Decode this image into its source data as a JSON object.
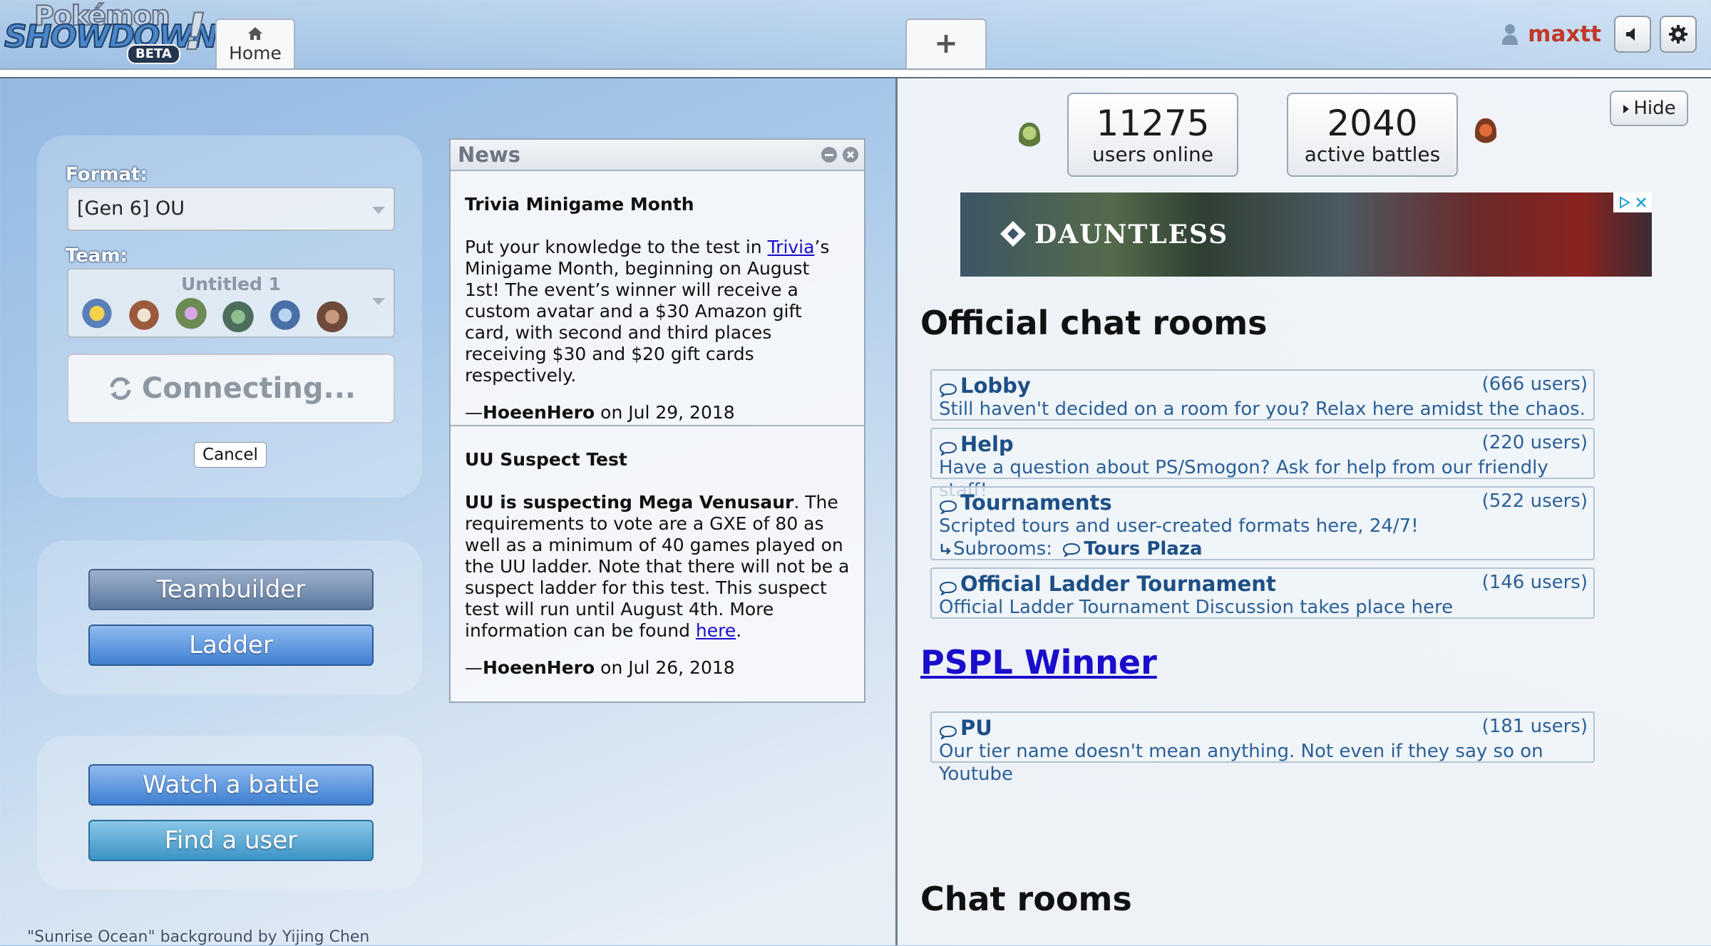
{
  "header": {
    "logo": {
      "top": "Pokémon",
      "main": "SHOWDOWN",
      "badge": "BETA"
    },
    "tabs": [
      {
        "label": "Home",
        "icon": "home-icon"
      },
      {
        "label": "+",
        "icon": "plus-icon"
      }
    ],
    "username": "maxtt",
    "username_color": "#c0392b"
  },
  "left": {
    "format_label": "Format:",
    "format_value": "[Gen 6] OU",
    "team_label": "Team:",
    "team_name": "Untitled 1",
    "connect_label": "Connecting...",
    "cancel_label": "Cancel",
    "buttons": {
      "teambuilder": "Teambuilder",
      "ladder": "Ladder",
      "watch": "Watch a battle",
      "find_user": "Find a user"
    },
    "credit": "\"Sunrise Ocean\" background by Yijing Chen"
  },
  "news": {
    "title": "News",
    "items": [
      {
        "headline": "Trivia Minigame Month",
        "body_before": "Put your knowledge to the test in ",
        "link": "Trivia",
        "body_after": "’s Minigame Month, beginning on August 1st! The event’s winner will receive a custom avatar and a $30 Amazon gift card, with second and third places receiving $30 and $20 gift cards respectively.",
        "author": "HoeenHero",
        "date": "on Jul 29, 2018"
      },
      {
        "headline": "UU Suspect Test",
        "bold_lead": "UU is suspecting Mega Venusaur",
        "body": ". The requirements to vote are a GXE of 80 as well as a minimum of 40 games played on the UU ladder. Note that there will not be a suspect ladder for this test. This suspect test will run until August 4th. More information can be found ",
        "link": "here",
        "body_end": ".",
        "author": "HoeenHero",
        "date": "on Jul 26, 2018"
      }
    ]
  },
  "right": {
    "users_online": "11275",
    "users_online_label": "users online",
    "active_battles": "2040",
    "active_battles_label": "active battles",
    "hide_label": "Hide",
    "ad_brand": "DAUNTLESS",
    "sections": {
      "official": "Official chat rooms",
      "pspl": "PSPL Winner",
      "chat": "Chat rooms"
    },
    "rooms": {
      "lobby": {
        "name": "Lobby",
        "users": "(666 users)",
        "desc": "Still haven't decided on a room for you? Relax here amidst the chaos."
      },
      "help": {
        "name": "Help",
        "users": "(220 users)",
        "desc": "Have a question about PS/Smogon? Ask for help from our friendly staff!"
      },
      "tournaments": {
        "name": "Tournaments",
        "users": "(522 users)",
        "desc": "Scripted tours and user-created formats here, 24/7!",
        "sub_label": "Subrooms:",
        "sub_room": "Tours Plaza"
      },
      "ladder": {
        "name": "Official Ladder Tournament",
        "users": "(146 users)",
        "desc": "Official Ladder Tournament Discussion takes place here"
      },
      "pu": {
        "name": "PU",
        "users": "(181 users)",
        "desc": "Our tier name doesn't mean anything. Not even if they say so on Youtube"
      }
    }
  }
}
